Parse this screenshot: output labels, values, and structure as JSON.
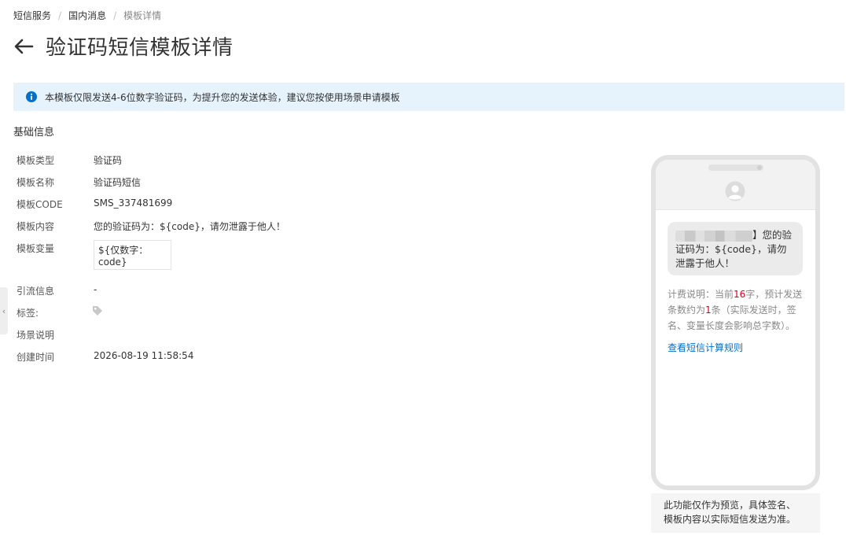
{
  "breadcrumb": [
    "短信服务",
    "国内消息",
    "模板详情"
  ],
  "page_title": "验证码短信模板详情",
  "notice": "本模板仅限发送4-6位数字验证码，为提升您的发送体验，建议您按使用场景申请模板",
  "section_title": "基础信息",
  "fields": {
    "type_label": "模板类型",
    "type_value": "验证码",
    "name_label": "模板名称",
    "name_value": "验证码短信",
    "code_label": "模板CODE",
    "code_value": "SMS_337481699",
    "content_label": "模板内容",
    "content_value": "您的验证码为：${code}，请勿泄露于他人！",
    "var_label": "模板变量",
    "var_value": "${仅数字：code}",
    "traffic_label": "引流信息",
    "traffic_value": "-",
    "tag_label": "标签:",
    "scene_label": "场景说明",
    "created_label": "创建时间",
    "created_value": "2026-08-19 11:58:54"
  },
  "preview": {
    "sign_suffix": "】您的",
    "message_rest": "验证码为：${code}，请勿泄露于他人！",
    "billing_prefix": "计费说明：当前",
    "char_count": "16",
    "billing_mid": "字，预计发送条数约为",
    "msg_count": "1",
    "billing_suffix": "条（实际发送时，签名、变量长度会影响总字数）。",
    "rule_link": "查看短信计算规则",
    "note_line1": "此功能仅作为预览，具体签名、",
    "note_line2": "模板内容以实际短信发送为准。"
  },
  "colors": {
    "accent": "#0070cc",
    "notice_bg": "#e6f3fd",
    "highlight": "#d9001b"
  }
}
